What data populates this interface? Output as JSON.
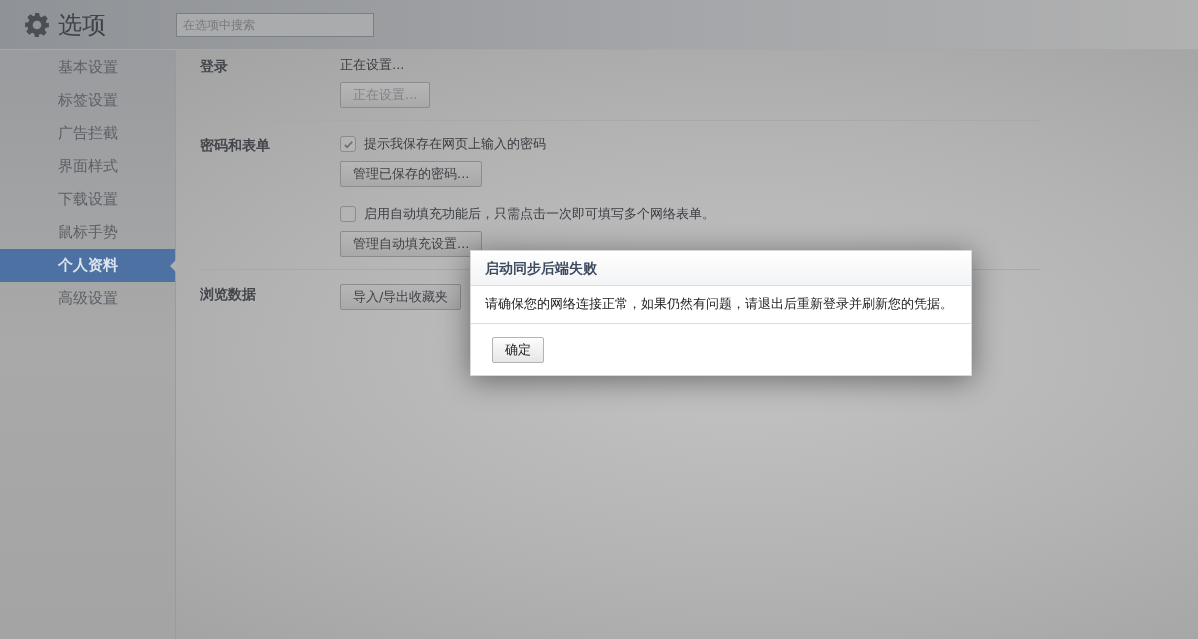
{
  "header": {
    "title": "选项",
    "search": {
      "placeholder": "在选项中搜索"
    }
  },
  "sidebar": {
    "items": [
      {
        "label": "基本设置",
        "selected": false
      },
      {
        "label": "标签设置",
        "selected": false
      },
      {
        "label": "广告拦截",
        "selected": false
      },
      {
        "label": "界面样式",
        "selected": false
      },
      {
        "label": "下载设置",
        "selected": false
      },
      {
        "label": "鼠标手势",
        "selected": false
      },
      {
        "label": "个人资料",
        "selected": true
      },
      {
        "label": "高级设置",
        "selected": false
      }
    ]
  },
  "sections": [
    {
      "title": "登录",
      "rows": [
        {
          "kind": "text",
          "text": "正在设置..."
        },
        {
          "kind": "button",
          "label": "正在设置...",
          "disabled": true
        }
      ]
    },
    {
      "title": "密码和表单",
      "rows": [
        {
          "kind": "checkbox",
          "label": "提示我保存在网页上输入的密码",
          "checked": true
        },
        {
          "kind": "button",
          "label": "管理已保存的密码...",
          "disabled": false
        },
        {
          "kind": "checkbox",
          "label": "启用自动填充功能后，只需点击一次即可填写多个网络表单。",
          "checked": false
        },
        {
          "kind": "button",
          "label": "管理自动填充设置...",
          "disabled": false
        }
      ]
    },
    {
      "title": "浏览数据",
      "rows": [
        {
          "kind": "button",
          "label": "导入/导出收藏夹",
          "disabled": false
        }
      ]
    }
  ],
  "dialog": {
    "title": "启动同步后端失败",
    "message": "请确保您的网络连接正常，如果仍然有问题，请退出后重新登录并刷新您的凭据。",
    "buttons": [
      "确定"
    ]
  }
}
